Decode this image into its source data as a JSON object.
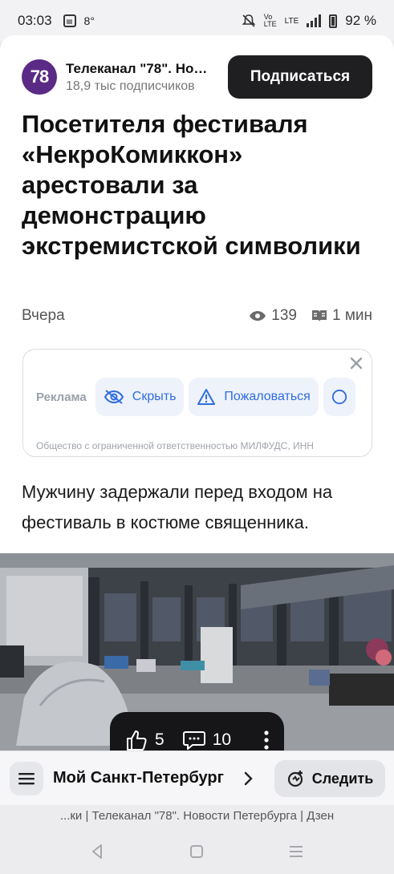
{
  "status_bar": {
    "time": "03:03",
    "temperature": "8°",
    "network": "LTE",
    "battery": "92 %"
  },
  "channel": {
    "logo_text": "78",
    "name": "Телеканал \"78\". Новости Петербурга",
    "subscribers": "18,9 тыс подписчиков",
    "subscribe_label": "Подписаться",
    "logo_color": "#5b2a86"
  },
  "article": {
    "title": "Посетителя фестиваля «НекроКомиккон» арестовали за демонстрацию экстремистской символики",
    "date": "Вчера",
    "views": "139",
    "read_time": "1 мин",
    "lead": "Мужчину задержали перед входом на фестиваль в костюме священника."
  },
  "ad": {
    "label": "Реклама",
    "hide_label": "Скрыть",
    "report_label": "Пожаловаться",
    "legal_text": "Общество с ограниченной ответственностью МИЛФУДС, ИНН"
  },
  "reactions": {
    "likes": "5",
    "comments": "10"
  },
  "bottom_bar": {
    "location": "Мой Санкт-Петербург",
    "follow_label": "Следить"
  },
  "footer_caption": "...ки | Телеканал \"78\". Новости Петербурга | Дзен",
  "colors": {
    "accent": "#2f6de0",
    "progress": "#ff4d2e",
    "dark_button": "#1f1f22"
  }
}
